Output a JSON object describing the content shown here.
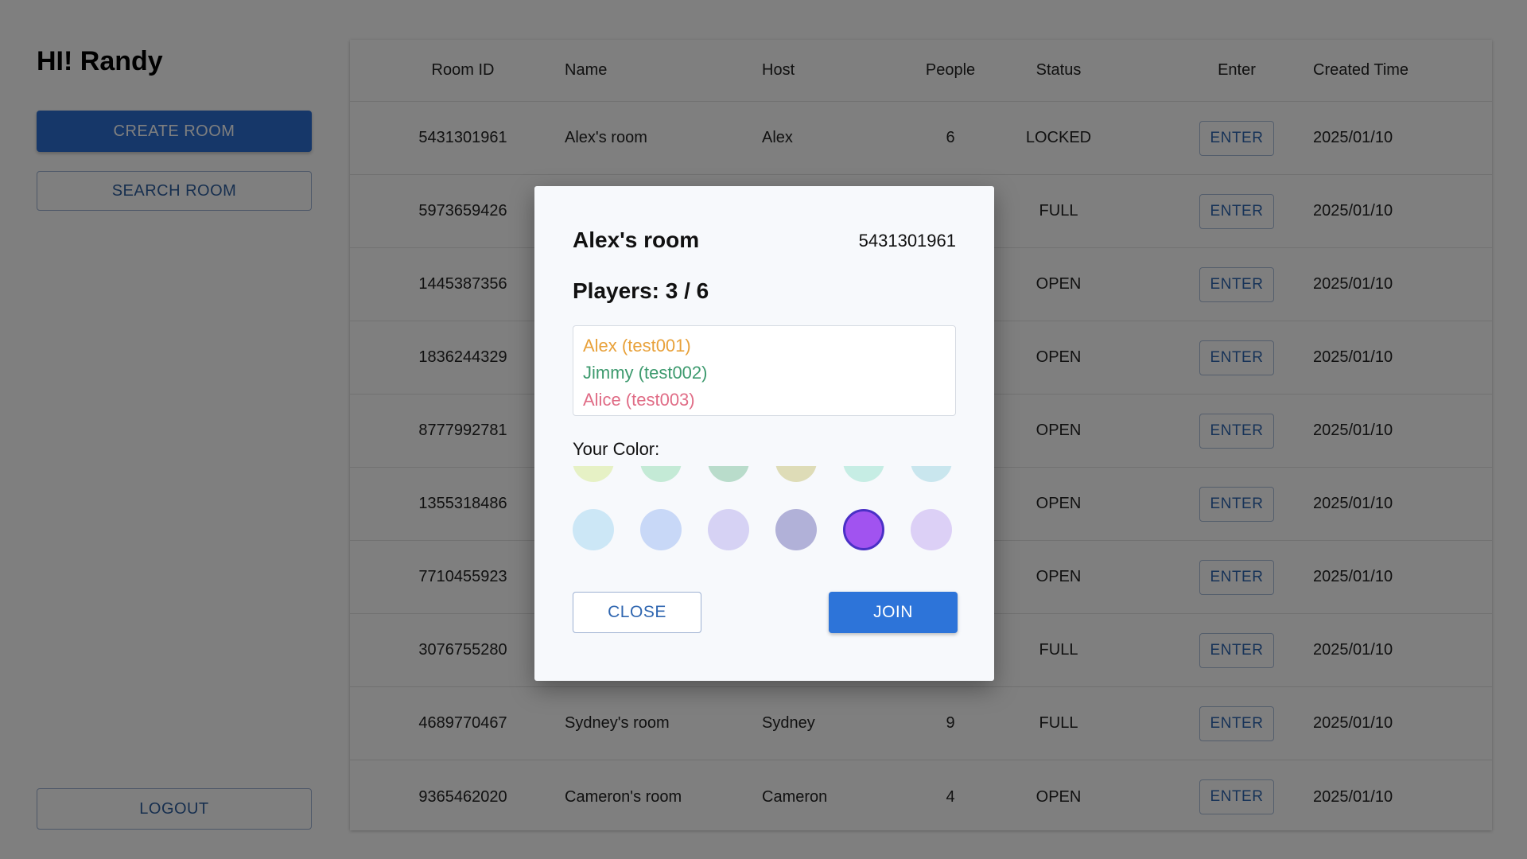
{
  "sidebar": {
    "greeting": "HI! Randy",
    "create_room_label": "CREATE ROOM",
    "search_room_label": "SEARCH ROOM",
    "logout_label": "LOGOUT"
  },
  "table": {
    "headers": [
      "Room ID",
      "Name",
      "Host",
      "People",
      "Status",
      "Enter",
      "Created Time"
    ],
    "rows": [
      {
        "room_id": "5431301961",
        "name": "Alex's room",
        "host": "Alex",
        "people": "6",
        "status": "LOCKED",
        "enter": "ENTER",
        "created": "2025/01/10"
      },
      {
        "room_id": "5973659426",
        "name": "",
        "host": "",
        "people": "",
        "status": "FULL",
        "enter": "ENTER",
        "created": "2025/01/10"
      },
      {
        "room_id": "1445387356",
        "name": "",
        "host": "",
        "people": "",
        "status": "OPEN",
        "enter": "ENTER",
        "created": "2025/01/10"
      },
      {
        "room_id": "1836244329",
        "name": "",
        "host": "",
        "people": "",
        "status": "OPEN",
        "enter": "ENTER",
        "created": "2025/01/10"
      },
      {
        "room_id": "8777992781",
        "name": "",
        "host": "",
        "people": "",
        "status": "OPEN",
        "enter": "ENTER",
        "created": "2025/01/10"
      },
      {
        "room_id": "1355318486",
        "name": "",
        "host": "",
        "people": "",
        "status": "OPEN",
        "enter": "ENTER",
        "created": "2025/01/10"
      },
      {
        "room_id": "7710455923",
        "name": "",
        "host": "",
        "people": "",
        "status": "OPEN",
        "enter": "ENTER",
        "created": "2025/01/10"
      },
      {
        "room_id": "3076755280",
        "name": "",
        "host": "",
        "people": "",
        "status": "FULL",
        "enter": "ENTER",
        "created": "2025/01/10"
      },
      {
        "room_id": "4689770467",
        "name": "Sydney's room",
        "host": "Sydney",
        "people": "9",
        "status": "FULL",
        "enter": "ENTER",
        "created": "2025/01/10"
      },
      {
        "room_id": "9365462020",
        "name": "Cameron's room",
        "host": "Cameron",
        "people": "4",
        "status": "OPEN",
        "enter": "ENTER",
        "created": "2025/01/10"
      }
    ]
  },
  "dialog": {
    "title": "Alex's room",
    "room_id": "5431301961",
    "players_label": "Players: 3 / 6",
    "players": [
      {
        "label": "Alex (test001)",
        "color": "#e8a13a"
      },
      {
        "label": "Jimmy (test002)",
        "color": "#3d9a6e"
      },
      {
        "label": "Alice (test003)",
        "color": "#e06c86"
      }
    ],
    "color_label": "Your Color:",
    "swatches_row1": [
      "#e6f1c5",
      "#c4ead6",
      "#b9dccb",
      "#dedcb7",
      "#c6ede4",
      "#c9e6ee"
    ],
    "swatches_row2": [
      "#cce7f6",
      "#c8d8f7",
      "#d6d2f4",
      "#b1b1d8",
      "#a153f0",
      "#dcd0f6"
    ],
    "selected_swatch": "#a153f0",
    "close_label": "CLOSE",
    "join_label": "JOIN"
  }
}
